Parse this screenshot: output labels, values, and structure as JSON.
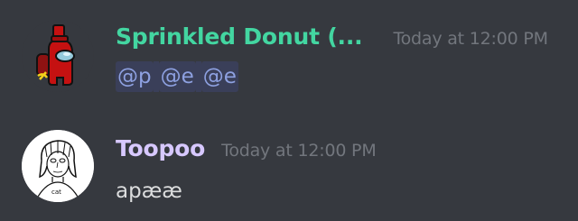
{
  "messages": [
    {
      "author": "Sprinkled Donut (...",
      "author_color": "#43d6a1",
      "timestamp": "Today at 12:00 PM",
      "avatar_icon": "red-crewmate-hammer-sickle-avatar",
      "mentions": [
        "@p",
        "@e",
        "@e"
      ]
    },
    {
      "author": "Toopoo",
      "author_color": "#d7c8ff",
      "timestamp": "Today at 12:00 PM",
      "avatar_icon": "sketch-portrait-avatar",
      "text": "apææ"
    }
  ]
}
